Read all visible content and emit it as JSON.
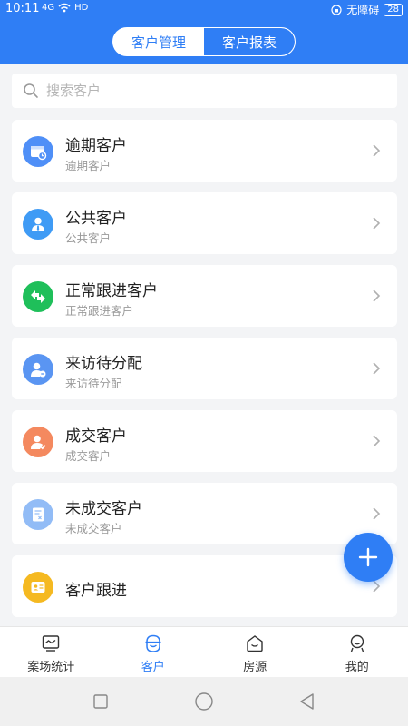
{
  "status": {
    "time": "10:11",
    "signal": "4G",
    "network": "HD",
    "accessibility": "无障碍",
    "battery": "28"
  },
  "header": {
    "tabs": [
      {
        "label": "客户管理",
        "active": false
      },
      {
        "label": "客户报表",
        "active": true
      }
    ]
  },
  "search": {
    "placeholder": "搜索客户"
  },
  "items": [
    {
      "title": "逾期客户",
      "subtitle": "逾期客户",
      "icon": "calendar-clock-icon",
      "color": "#4f8ff7"
    },
    {
      "title": "公共客户",
      "subtitle": "公共客户",
      "icon": "person-tie-icon",
      "color": "#3f9bf5"
    },
    {
      "title": "正常跟进客户",
      "subtitle": "正常跟进客户",
      "icon": "swap-arrows-icon",
      "color": "#1fbf5a"
    },
    {
      "title": "来访待分配",
      "subtitle": "来访待分配",
      "icon": "person-assign-icon",
      "color": "#5a95f2"
    },
    {
      "title": "成交客户",
      "subtitle": "成交客户",
      "icon": "person-check-icon",
      "color": "#f4895f"
    },
    {
      "title": "未成交客户",
      "subtitle": "未成交客户",
      "icon": "document-x-icon",
      "color": "#92bcf6"
    },
    {
      "title": "客户跟进",
      "subtitle": "",
      "icon": "id-card-icon",
      "color": "#f5b921"
    }
  ],
  "tabbar": [
    {
      "label": "案场统计",
      "icon": "monitor-icon",
      "active": false
    },
    {
      "label": "客户",
      "icon": "smile-face-icon",
      "active": true
    },
    {
      "label": "房源",
      "icon": "house-icon",
      "active": false
    },
    {
      "label": "我的",
      "icon": "profile-face-icon",
      "active": false
    }
  ]
}
